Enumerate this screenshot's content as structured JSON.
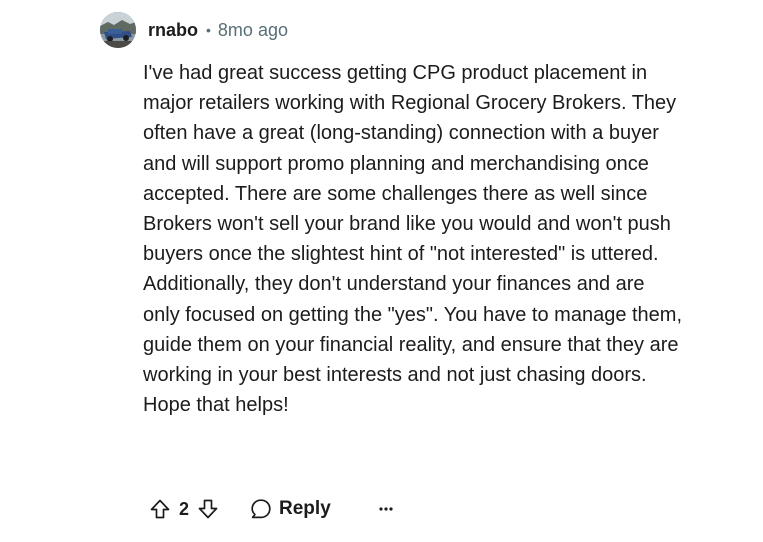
{
  "comment": {
    "username": "rnabo",
    "separator": "•",
    "timestamp": "8mo ago",
    "avatar_icon": "user-avatar-photo",
    "body": "I've had great success getting CPG product placement in major retailers working with Regional Grocery Brokers. They often have a great (long-standing) connection with a buyer and will support promo planning and merchandising once accepted. There are some challenges there as well since Brokers won't sell your brand like you would and won't push buyers once the slightest hint of \"not interested\" is uttered. Additionally, they don't understand your finances and are only focused on getting the \"yes\". You have to manage them, guide them on your financial reality, and ensure that they are working in your best interests and not just chasing doors. Hope that helps!"
  },
  "actions": {
    "upvote_icon": "upvote-arrow-icon",
    "vote_count": "2",
    "downvote_icon": "downvote-arrow-icon",
    "reply_icon": "speech-bubble-icon",
    "reply_label": "Reply",
    "more_icon": "ellipsis-icon"
  },
  "colors": {
    "text": "#1c1c1c",
    "meta": "#576f76"
  }
}
